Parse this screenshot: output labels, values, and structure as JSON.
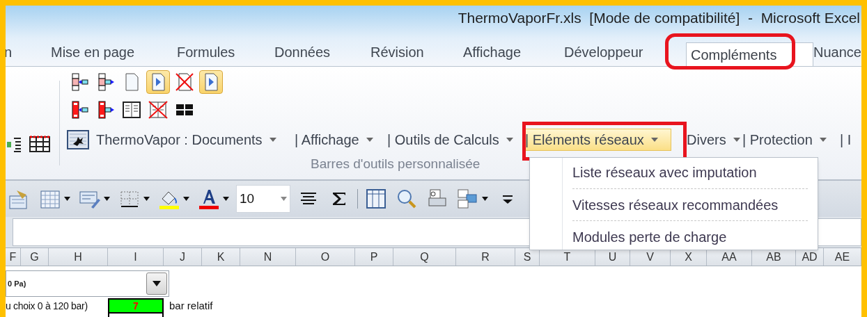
{
  "window": {
    "title": "ThermoVaporFr.xls  [Mode de compatibilité]  -  Microsoft Excel"
  },
  "tabs": [
    {
      "label": "n",
      "selected": false
    },
    {
      "label": "Mise en page",
      "selected": false
    },
    {
      "label": "Formules",
      "selected": false
    },
    {
      "label": "Données",
      "selected": false
    },
    {
      "label": "Révision",
      "selected": false
    },
    {
      "label": "Affichage",
      "selected": false
    },
    {
      "label": "Développeur",
      "selected": false
    },
    {
      "label": "Compléments",
      "selected": true
    },
    {
      "label": "Nuance",
      "selected": false
    }
  ],
  "ribbon": {
    "icon_rows": [
      [
        {
          "kind": "shift-left",
          "pressed": false
        },
        {
          "kind": "shift-right",
          "pressed": false
        },
        {
          "kind": "page",
          "pressed": false
        },
        {
          "kind": "page-arrow",
          "pressed": true
        },
        {
          "kind": "page-crossed",
          "pressed": false
        },
        {
          "kind": "page-arrow",
          "pressed": true
        }
      ],
      [
        {
          "kind": "shift-left-red",
          "pressed": false
        },
        {
          "kind": "shift-right-red",
          "pressed": false
        },
        {
          "kind": "columns",
          "pressed": false
        },
        {
          "kind": "columns-crossed",
          "pressed": false
        },
        {
          "kind": "grid",
          "pressed": false
        }
      ]
    ],
    "menus": [
      {
        "label": "ThermoVapor : Documents",
        "selected": false
      },
      {
        "label": "| Affichage",
        "selected": false
      },
      {
        "label": "| Outils de Calculs",
        "selected": false
      },
      {
        "label": "| Eléments réseaux",
        "selected": true
      },
      {
        "label": "Divers",
        "selected": false
      },
      {
        "label": "| Protection",
        "selected": false
      },
      {
        "label": "| I",
        "selected": false
      }
    ],
    "group_label": "Barres d'outils personnalisée"
  },
  "dropdown_menu": {
    "items": [
      "Liste réseaux avec imputation",
      "Vitesses réseaux recommandées",
      "Modules perte de charge"
    ]
  },
  "toolbar": {
    "font_size": "10"
  },
  "sheet": {
    "columns": [
      "F",
      "G",
      "H",
      "I",
      "J",
      "K",
      "N",
      "O",
      "P",
      "Q",
      "R",
      "S",
      "T",
      "U",
      "V",
      "X",
      "AA",
      "AB",
      "AD",
      "AE"
    ],
    "dropdown_value": "0 Pa)",
    "row_label": "u choix 0 à 120 bar)",
    "value": "7",
    "unit": "bar relatif"
  }
}
